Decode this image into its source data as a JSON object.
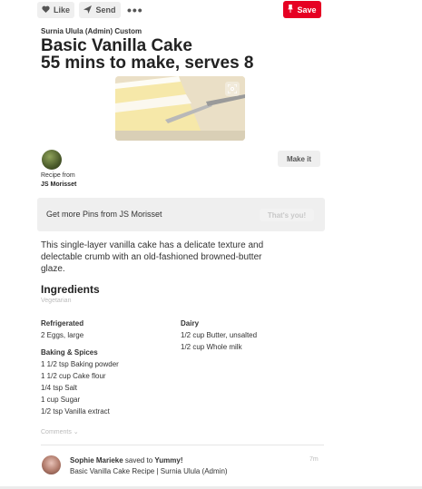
{
  "toolbar": {
    "like_label": "Like",
    "send_label": "Send",
    "more_label": "•••",
    "save_label": "Save"
  },
  "pin": {
    "board_line": "Surnia Ulula (Admin) Custom",
    "title_line1": "Basic Vanilla Cake",
    "title_line2": "55 mins to make, serves 8",
    "description": "This single-layer vanilla cake has a delicate texture and delectable crumb with an old-fashioned browned-butter glaze."
  },
  "recipe_from": {
    "label": "Recipe from",
    "author": "JS Morisset",
    "make_it_label": "Make it"
  },
  "more_pins": {
    "text": "Get more Pins from JS Morisset",
    "button_label": "That's you!"
  },
  "ingredients": {
    "heading": "Ingredients",
    "diet": "Vegetarian",
    "groups": [
      {
        "name": "Refrigerated",
        "items": [
          "2 Eggs, large"
        ]
      },
      {
        "name": "Baking & Spices",
        "items": [
          "1 1/2 tsp Baking powder",
          "1 1/2 cup Cake flour",
          "1/4 tsp Salt",
          "1 cup Sugar",
          "1/2 tsp Vanilla extract"
        ]
      },
      {
        "name": "Dairy",
        "items": [
          "1/2 cup Butter, unsalted",
          "1/2 cup Whole milk"
        ]
      }
    ]
  },
  "comments_label": "Comments ⌄",
  "activity": {
    "user": "Sophie Marieke",
    "action": " saved to ",
    "board": "Yummy!",
    "subtitle": "Basic Vanilla Cake Recipe | Surnia Ulula (Admin)",
    "time": "7m"
  }
}
